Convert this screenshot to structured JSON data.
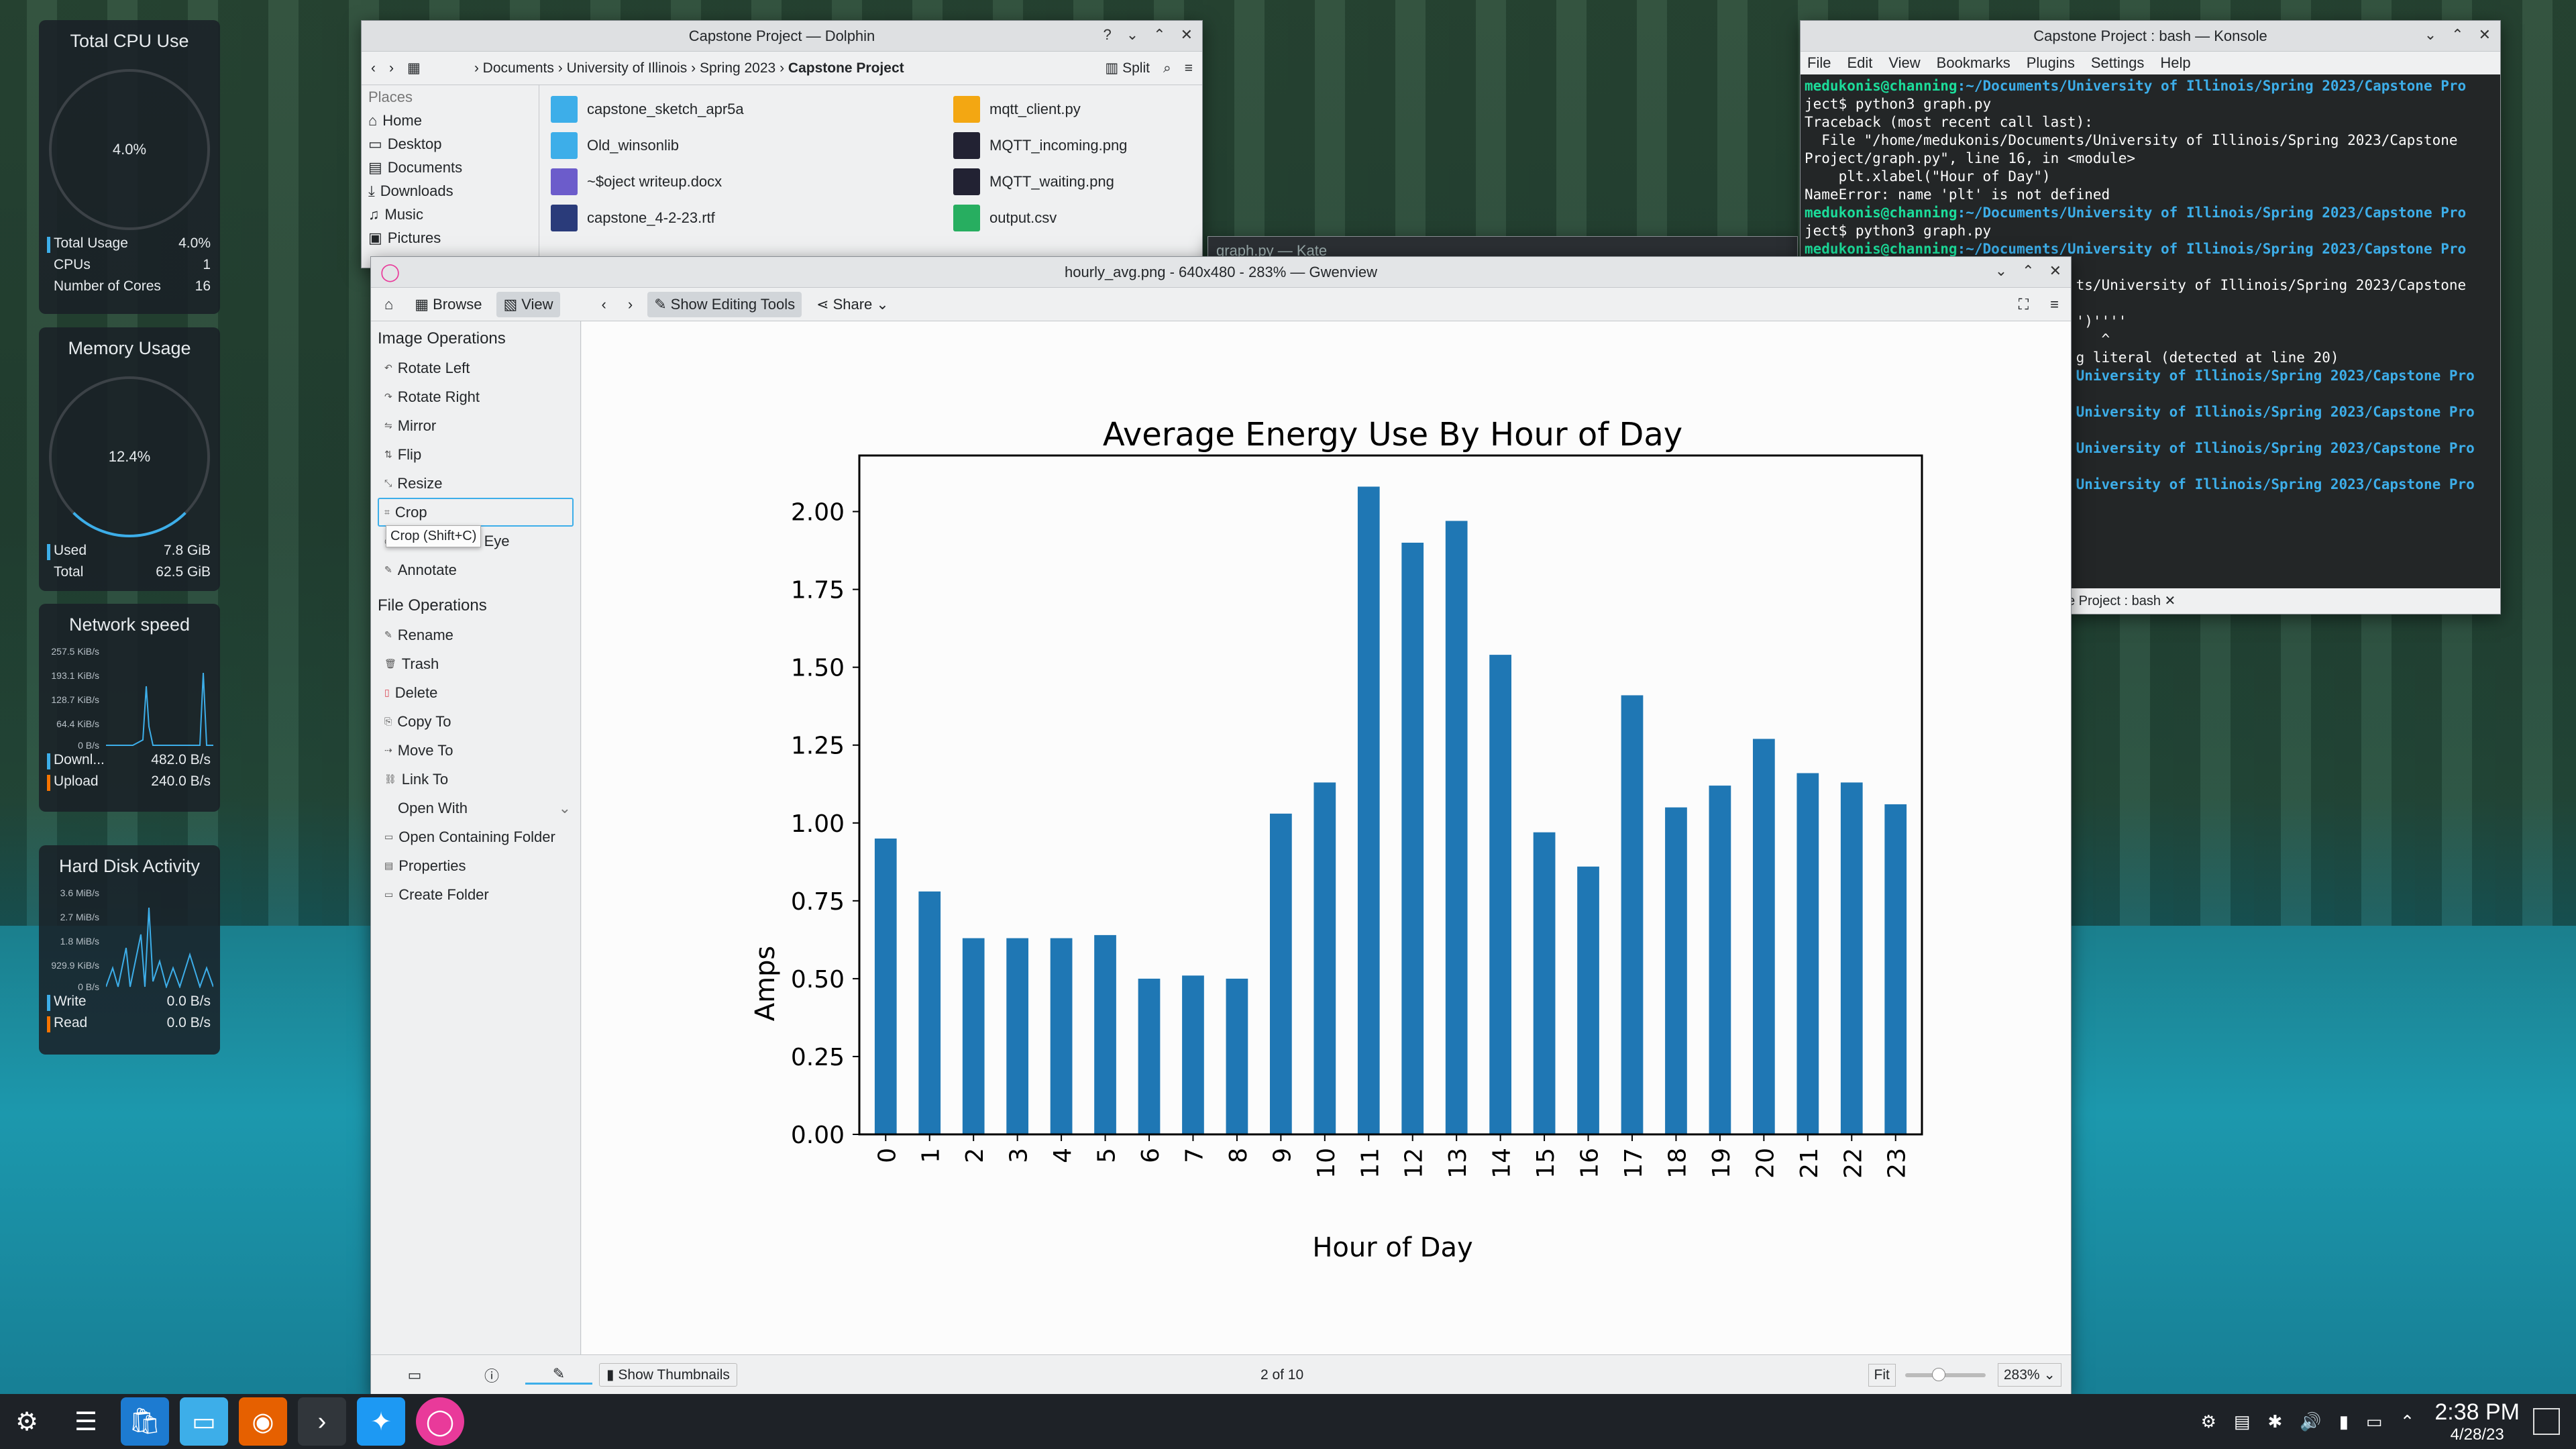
{
  "widgets": {
    "cpu": {
      "title": "Total CPU Use",
      "pct": "4.0%",
      "rows": [
        {
          "k": "Total Usage",
          "v": "4.0%"
        },
        {
          "k": "CPUs",
          "v": "1"
        },
        {
          "k": "Number of Cores",
          "v": "16"
        }
      ]
    },
    "mem": {
      "title": "Memory Usage",
      "pct": "12.4%",
      "rows": [
        {
          "k": "Used",
          "v": "7.8 GiB"
        },
        {
          "k": "Total",
          "v": "62.5 GiB"
        }
      ]
    },
    "net": {
      "title": "Network speed",
      "ticks": [
        "257.5 KiB/s",
        "193.1 KiB/s",
        "128.7 KiB/s",
        "64.4 KiB/s",
        "0 B/s"
      ],
      "rows": [
        {
          "k": "Downl...",
          "v": "482.0 B/s"
        },
        {
          "k": "Upload",
          "v": "240.0 B/s"
        }
      ]
    },
    "disk": {
      "title": "Hard Disk Activity",
      "ticks": [
        "3.6 MiB/s",
        "2.7 MiB/s",
        "1.8 MiB/s",
        "929.9 KiB/s",
        "0 B/s"
      ],
      "rows": [
        {
          "k": "Write",
          "v": "0.0 B/s"
        },
        {
          "k": "Read",
          "v": "0.0 B/s"
        }
      ]
    }
  },
  "dolphin": {
    "title": "Capstone Project — Dolphin",
    "crumbs": [
      "Documents",
      "University of Illinois",
      "Spring 2023",
      "Capstone Project"
    ],
    "split": "Split",
    "places_header": "Places",
    "places": [
      "Home",
      "Desktop",
      "Documents",
      "Downloads",
      "Music",
      "Pictures"
    ],
    "files_left": [
      "capstone_sketch_apr5a",
      "Old_winsonlib",
      "~$oject writeup.docx",
      "capstone_4-2-23.rtf"
    ],
    "files_right": [
      "mqtt_client.py",
      "MQTT_incoming.png",
      "MQTT_waiting.png",
      "output.csv"
    ]
  },
  "kate": {
    "title": "graph.py — Kate"
  },
  "konsole": {
    "title": "Capstone Project : bash — Konsole",
    "menu": [
      "File",
      "Edit",
      "View",
      "Bookmarks",
      "Plugins",
      "Settings",
      "Help"
    ],
    "prompt_user": "medukonis@channing",
    "prompt_path": ":~/Documents/University of Illinois/Spring 2023/Capstone Pro",
    "lines": [
      "ject$ python3 graph.py",
      "Traceback (most recent call last):",
      "  File \"/home/medukonis/Documents/University of Illinois/Spring 2023/Capstone",
      "Project/graph.py\", line 16, in <module>",
      "    plt.xlabel(\"Hour of Day\")",
      "NameError: name 'plt' is not defined"
    ],
    "line2": "ject$ python3 graph.py",
    "partial": [
      "ts/University of Illinois/Spring 2023/Capstone",
      "')''''",
      "   ^",
      "g literal (detected at line 20)"
    ],
    "partial_blue": "University of Illinois/Spring 2023/Capstone Pro",
    "tab": "e Project : bash"
  },
  "gwen": {
    "title": "hourly_avg.png - 640x480 - 283% — Gwenview",
    "browse": "Browse",
    "view": "View",
    "editing": "Show Editing Tools",
    "share": "Share",
    "img_ops_header": "Image Operations",
    "img_ops": [
      "Rotate Left",
      "Rotate Right",
      "Mirror",
      "Flip",
      "Resize",
      "Crop",
      "Reduce Red Eye",
      "Annotate"
    ],
    "tooltip": "Crop (Shift+C)",
    "file_ops_header": "File Operations",
    "file_ops": [
      "Rename",
      "Trash",
      "Delete",
      "Copy To",
      "Move To",
      "Link To",
      "Open With",
      "Open Containing Folder",
      "Properties",
      "Create Folder"
    ],
    "thumbnails": "Show Thumbnails",
    "counter": "2 of 10",
    "fit": "Fit",
    "zoom": "283%"
  },
  "chart_data": {
    "type": "bar",
    "title": "Average Energy Use By Hour of Day",
    "xlabel": "Hour of Day",
    "ylabel": "Amps",
    "categories": [
      "0",
      "1",
      "2",
      "3",
      "4",
      "5",
      "6",
      "7",
      "8",
      "9",
      "10",
      "11",
      "12",
      "13",
      "14",
      "15",
      "16",
      "17",
      "18",
      "19",
      "20",
      "21",
      "22",
      "23"
    ],
    "values": [
      0.95,
      0.78,
      0.63,
      0.63,
      0.63,
      0.64,
      0.5,
      0.51,
      0.5,
      1.03,
      1.13,
      2.08,
      1.9,
      1.97,
      1.54,
      0.97,
      0.86,
      1.41,
      1.05,
      1.12,
      1.27,
      1.16,
      1.13,
      1.06
    ],
    "ylim": [
      0,
      2.18
    ],
    "yticks": [
      "0.00",
      "0.25",
      "0.50",
      "0.75",
      "1.00",
      "1.25",
      "1.50",
      "1.75",
      "2.00"
    ],
    "color": "#1f77b4"
  },
  "taskbar": {
    "time": "2:38 PM",
    "date": "4/28/23"
  }
}
